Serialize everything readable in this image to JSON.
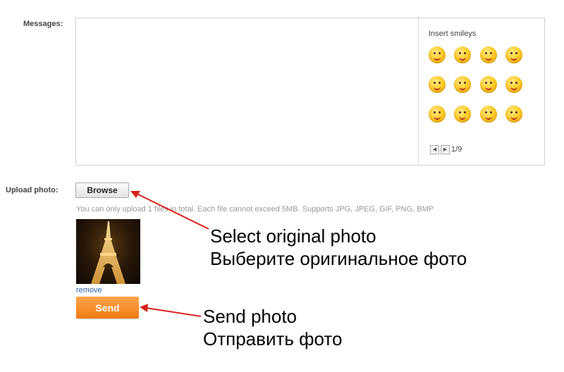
{
  "form": {
    "messages_label": "Messages:",
    "message_value": "",
    "upload_label": "Upload photo:",
    "browse_label": "Browse",
    "upload_hint": "You can only upload 1 files in total. Each file cannot exceed 5MB. Supports JPG, JPEG, GIF, PNG, BMP",
    "remove_label": "remove",
    "send_label": "Send"
  },
  "smileys": {
    "title": "Insert smileys",
    "items": [
      "smile-icon",
      "wink-icon",
      "blush-icon",
      "grin-icon",
      "tongue-icon",
      "shout-icon",
      "laugh-icon",
      "giggle-icon",
      "hug-icon",
      "dance-icon",
      "shy-icon",
      "happy-icon"
    ],
    "pager": "1/9"
  },
  "annotations": {
    "select_en": "Select original photo",
    "select_ru": "Выберите оригинальное фото",
    "send_en": "Send photo",
    "send_ru": "Отправить фото"
  },
  "colors": {
    "send_button": "#f5871f",
    "arrow": "#d8221c",
    "link": "#2a5db0"
  }
}
